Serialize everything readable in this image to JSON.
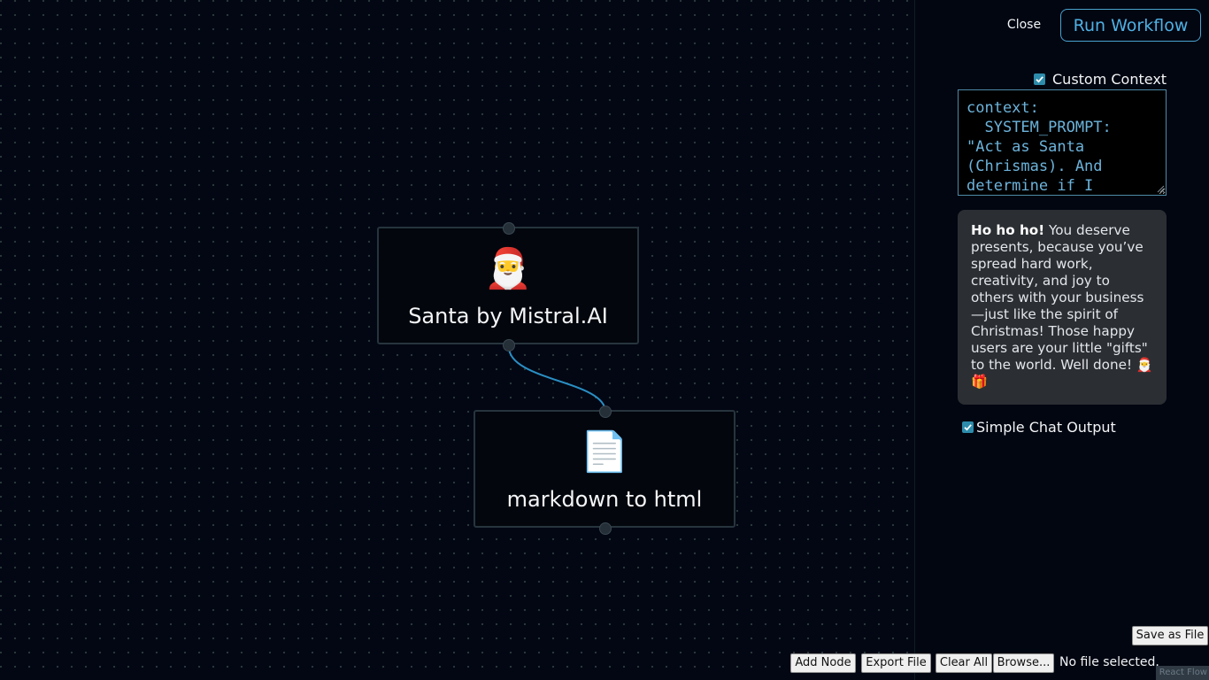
{
  "canvas": {
    "nodes": [
      {
        "emoji": "🎅",
        "title": "Santa by Mistral.AI"
      },
      {
        "emoji": "📄",
        "title": "markdown to html"
      }
    ]
  },
  "header": {
    "close_label": "Close",
    "run_label": "Run Workflow"
  },
  "panel": {
    "custom_context_label": "Custom Context",
    "custom_context_checked": true,
    "context_text": "context:\n  SYSTEM_PROMPT:\n\"Act as Santa\n(Chrismas). And\ndetermine if I",
    "chat": {
      "bold": "Ho ho ho!",
      "text": " You deserve presents, because you’ve spread hard work, creativity, and joy to others with your business—just like the spirit of Christmas! Those happy users are your little \"gifts\" to the world. Well done! 🎅🎁"
    },
    "simple_chat_label": "Simple Chat Output",
    "simple_chat_checked": true
  },
  "footer": {
    "save_as_file": "Save as File",
    "add_node": "Add Node",
    "export_file": "Export File",
    "clear_all": "Clear All",
    "browse": "Browse...",
    "no_file": "No file selected.",
    "watermark": "React Flow"
  },
  "colors": {
    "accent": "#4fb0e3",
    "checkbox": "#2d8cab",
    "edge": "#2a8fc4",
    "background": "#030714"
  },
  "icons": {
    "checkbox": "check-icon",
    "santa": "santa-emoji",
    "document": "page-emoji"
  }
}
